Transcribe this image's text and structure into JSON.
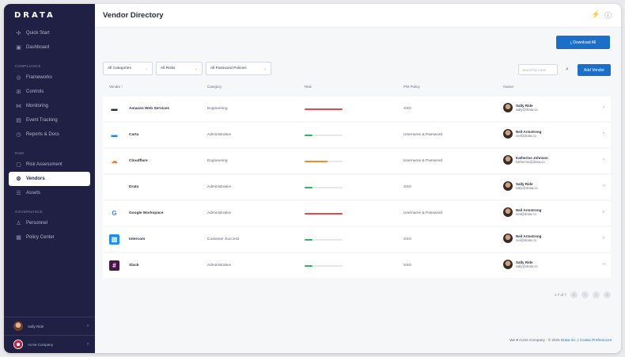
{
  "app": {
    "logo_text": "DRATA",
    "page_title": "Vendor Directory"
  },
  "sidebar": {
    "top_items": [
      {
        "label": "Quick Start",
        "icon": "rocket-icon"
      },
      {
        "label": "Dashboard",
        "icon": "dashboard-icon"
      }
    ],
    "compliance_header": "COMPLIANCE",
    "compliance_items": [
      {
        "label": "Frameworks",
        "icon": "frameworks-icon"
      },
      {
        "label": "Controls",
        "icon": "controls-icon"
      },
      {
        "label": "Monitoring",
        "icon": "monitoring-icon"
      },
      {
        "label": "Event Tracking",
        "icon": "event-icon"
      },
      {
        "label": "Reports & Docs",
        "icon": "reports-icon"
      }
    ],
    "risk_header": "RISK",
    "risk_items": [
      {
        "label": "Risk Assessment",
        "icon": "risk-icon"
      },
      {
        "label": "Vendors",
        "icon": "vendors-icon"
      },
      {
        "label": "Assets",
        "icon": "assets-icon"
      }
    ],
    "governance_header": "GOVERNANCE",
    "governance_items": [
      {
        "label": "Personnel",
        "icon": "personnel-icon"
      },
      {
        "label": "Policy Center",
        "icon": "policy-icon"
      }
    ],
    "user_name": "Sally Ride",
    "company_name": "Acme Company"
  },
  "toolbar": {
    "download_label": "⤓ Download All",
    "category_select": "All Categories",
    "risk_select": "All Risks",
    "password_select": "All Password Policies",
    "search_placeholder": "Search by name",
    "add_vendor_label": "Add Vendor"
  },
  "table": {
    "headers": {
      "vendor": "Vendor ↑",
      "category": "Category",
      "risk": "Risk",
      "pw_policy": "PW Policy",
      "owner": "Owner"
    },
    "rows": [
      {
        "name": "Amazon Web Services",
        "category": "Engineering",
        "risk_level": 1.0,
        "risk_color": "#e5484d",
        "pw_policy": "SSO",
        "owner_name": "Sally Ride",
        "owner_email": "sally@drata.co",
        "logo": "aws",
        "logo_color": "#232f3e"
      },
      {
        "name": "Carta",
        "category": "Administrative",
        "risk_level": 0.2,
        "risk_color": "#2fb75d",
        "pw_policy": "Username & Password",
        "owner_name": "Neil Armstrong",
        "owner_email": "neil@drata.co",
        "logo": "carta",
        "logo_color": "#1d8ae0"
      },
      {
        "name": "Cloudflare",
        "category": "Engineering",
        "risk_level": 0.6,
        "risk_color": "#f28b30",
        "pw_policy": "Username & Password",
        "owner_name": "Katherine Johnson",
        "owner_email": "katherine@drata.co",
        "logo": "cloud",
        "logo_color": "#f38020"
      },
      {
        "name": "Drata",
        "category": "Administrative",
        "risk_level": 0.2,
        "risk_color": "#2fb75d",
        "pw_policy": "SSO",
        "owner_name": "Sally Ride",
        "owner_email": "sally@drata.co",
        "logo": "",
        "logo_color": "#ffffff"
      },
      {
        "name": "Google Workspace",
        "category": "Administrative",
        "risk_level": 1.0,
        "risk_color": "#e5484d",
        "pw_policy": "Username & Password",
        "owner_name": "Neil Armstrong",
        "owner_email": "neil@drata.co",
        "logo": "G",
        "logo_color": "#4285f4"
      },
      {
        "name": "Intercom",
        "category": "Customer Success",
        "risk_level": 0.2,
        "risk_color": "#2fb75d",
        "pw_policy": "SSO",
        "owner_name": "Neil Armstrong",
        "owner_email": "neil@drata.co",
        "logo": "intercom",
        "logo_color": "#1f8ded"
      },
      {
        "name": "Slack",
        "category": "Administrative",
        "risk_level": 0.2,
        "risk_color": "#2fb75d",
        "pw_policy": "SSO",
        "owner_name": "Sally Ride",
        "owner_email": "sally@drata.co",
        "logo": "slack",
        "logo_color": "#4a154b"
      }
    ]
  },
  "pagination": {
    "label": "1-7 of 7"
  },
  "footer": {
    "text_prefix": "We ♥ Acme Company · © 2021 ",
    "link_drata": "Drata Inc.",
    "separator": " | ",
    "link_cookies": "Cookie Preferences"
  },
  "colors": {
    "sidebar_bg": "#1f2044",
    "accent": "#1b6fc9"
  }
}
